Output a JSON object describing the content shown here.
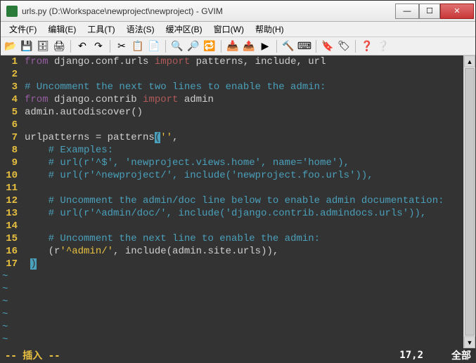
{
  "window": {
    "title": "urls.py (D:\\Workspace\\newproject\\newproject) - GVIM"
  },
  "menu": {
    "file": "文件(F)",
    "edit": "编辑(E)",
    "tools": "工具(T)",
    "syntax": "语法(S)",
    "buffers": "缓冲区(B)",
    "window": "窗口(W)",
    "help": "帮助(H)"
  },
  "code": {
    "lines": [
      {
        "n": "1",
        "spans": [
          {
            "t": "from ",
            "c": "kw-from"
          },
          {
            "t": "django.conf.urls ",
            "c": "ident"
          },
          {
            "t": "import ",
            "c": "kw-import"
          },
          {
            "t": "patterns, include, url",
            "c": "ident"
          }
        ]
      },
      {
        "n": "2",
        "spans": []
      },
      {
        "n": "3",
        "spans": [
          {
            "t": "# Uncomment the next two lines to enable the admin:",
            "c": "comment"
          }
        ]
      },
      {
        "n": "4",
        "spans": [
          {
            "t": "from ",
            "c": "kw-from"
          },
          {
            "t": "django.contrib ",
            "c": "ident"
          },
          {
            "t": "import ",
            "c": "kw-import"
          },
          {
            "t": "admin",
            "c": "ident"
          }
        ]
      },
      {
        "n": "5",
        "spans": [
          {
            "t": "admin.autodiscover()",
            "c": "ident"
          }
        ]
      },
      {
        "n": "6",
        "spans": []
      },
      {
        "n": "7",
        "spans": [
          {
            "t": "urlpatterns = patterns",
            "c": "ident"
          },
          {
            "t": "(",
            "c": "cursor"
          },
          {
            "t": "''",
            "c": "str"
          },
          {
            "t": ",",
            "c": "ident"
          }
        ]
      },
      {
        "n": "8",
        "spans": [
          {
            "t": "    ",
            "c": ""
          },
          {
            "t": "# Examples:",
            "c": "comment"
          }
        ]
      },
      {
        "n": "9",
        "spans": [
          {
            "t": "    ",
            "c": ""
          },
          {
            "t": "# url(r'^$', 'newproject.views.home', name='home'),",
            "c": "comment"
          }
        ]
      },
      {
        "n": "10",
        "spans": [
          {
            "t": "    ",
            "c": ""
          },
          {
            "t": "# url(r'^newproject/', include('newproject.foo.urls')),",
            "c": "comment"
          }
        ]
      },
      {
        "n": "11",
        "spans": []
      },
      {
        "n": "12",
        "spans": [
          {
            "t": "    ",
            "c": ""
          },
          {
            "t": "# Uncomment the admin/doc line below to enable admin documentation:",
            "c": "comment"
          }
        ]
      },
      {
        "n": "13",
        "spans": [
          {
            "t": "    ",
            "c": ""
          },
          {
            "t": "# url(r'^admin/doc/', include('django.contrib.admindocs.urls')),",
            "c": "comment"
          }
        ]
      },
      {
        "n": "14",
        "spans": []
      },
      {
        "n": "15",
        "spans": [
          {
            "t": "    ",
            "c": ""
          },
          {
            "t": "# Uncomment the next line to enable the admin:",
            "c": "comment"
          }
        ]
      },
      {
        "n": "16",
        "spans": [
          {
            "t": "    (r",
            "c": "ident"
          },
          {
            "t": "'^admin/'",
            "c": "str"
          },
          {
            "t": ", include(admin.site.urls)),",
            "c": "ident"
          }
        ]
      },
      {
        "n": "17",
        "spans": [
          {
            "t": " ",
            "c": ""
          },
          {
            "t": ")",
            "c": "cursor"
          }
        ]
      }
    ],
    "tildes": 6
  },
  "status": {
    "mode": "-- 插入 --",
    "pos": "17,2",
    "right": "全部"
  }
}
